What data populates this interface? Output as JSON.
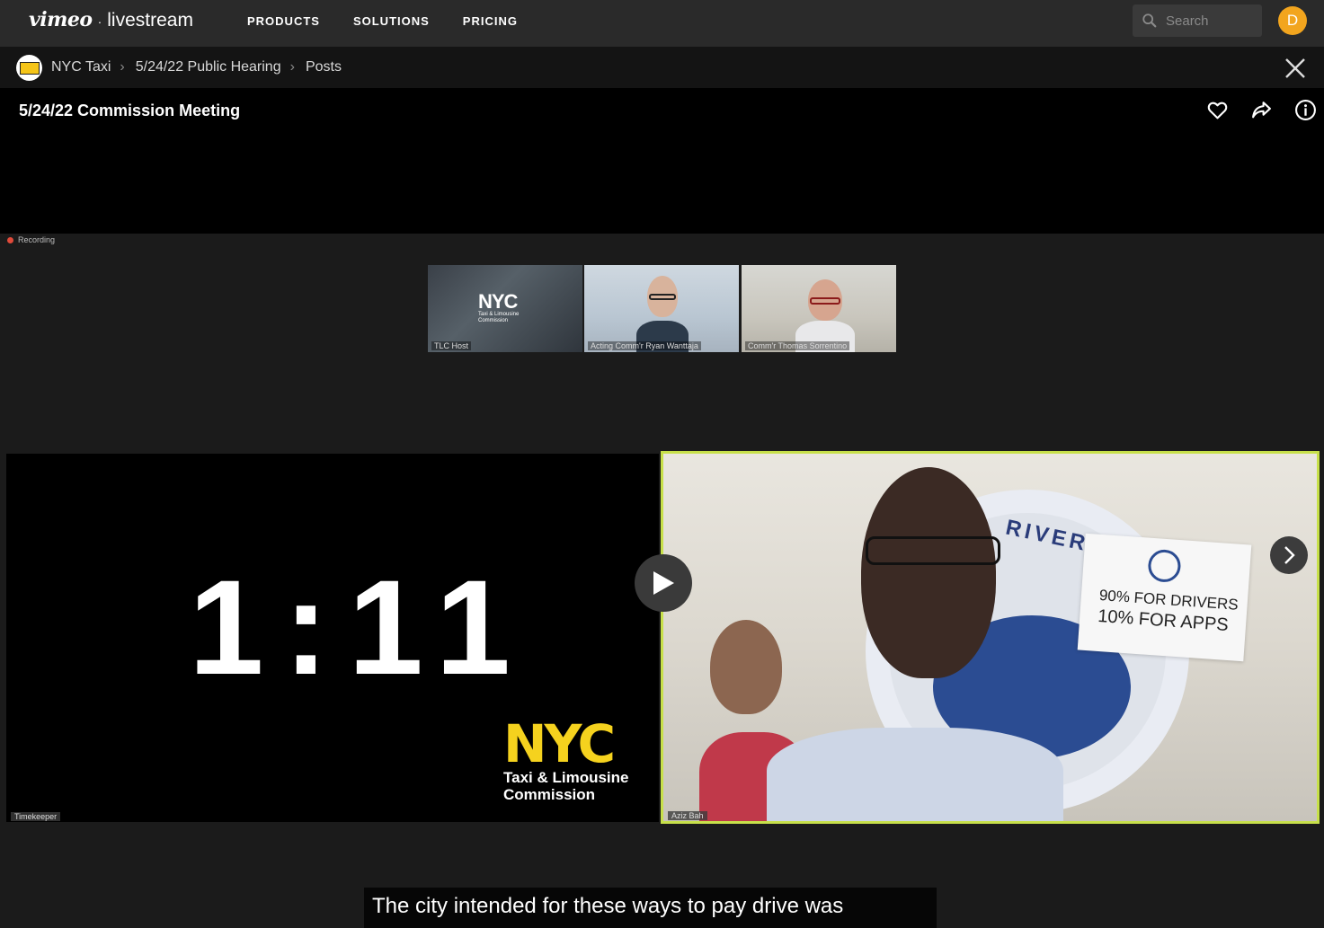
{
  "brand": {
    "vimeo": "vimeo",
    "separator": "·",
    "livestream": "livestream"
  },
  "nav": {
    "items": [
      "PRODUCTS",
      "SOLUTIONS",
      "PRICING"
    ]
  },
  "search": {
    "placeholder": "Search"
  },
  "user": {
    "initial": "D",
    "color": "#f2a51e"
  },
  "breadcrumb": {
    "items": [
      "NYC Taxi",
      "5/24/22 Public Hearing",
      "Posts"
    ]
  },
  "post": {
    "title": "5/24/22 Commission Meeting"
  },
  "meeting": {
    "recording_label": "Recording",
    "participants": [
      {
        "name": "TLC Host"
      },
      {
        "name": "Acting Comm'r Ryan Wanttaja"
      },
      {
        "name": "Comm'r Thomas Sorrentino"
      }
    ],
    "thumb_logo": {
      "brand": "NYC",
      "line1": "Taxi & Limousine",
      "line2": "Commission"
    },
    "timer": "1:11",
    "timer_tile_label": "Timekeeper",
    "logo": {
      "brand": "NYC",
      "line1": "Taxi & Limousine",
      "line2": "Commission"
    },
    "speaker_tile_label": "Aziz Bah",
    "sign": {
      "line1": "90% FOR DRIVERS",
      "line2": "10% FOR APPS"
    },
    "banner_text": "RIVERS"
  },
  "caption": "The city intended for these ways to pay drive was",
  "colors": {
    "active_speaker_border": "#c7e04a",
    "nav_bg": "#2a2a2a",
    "tlc_yellow": "#f5d21e"
  }
}
